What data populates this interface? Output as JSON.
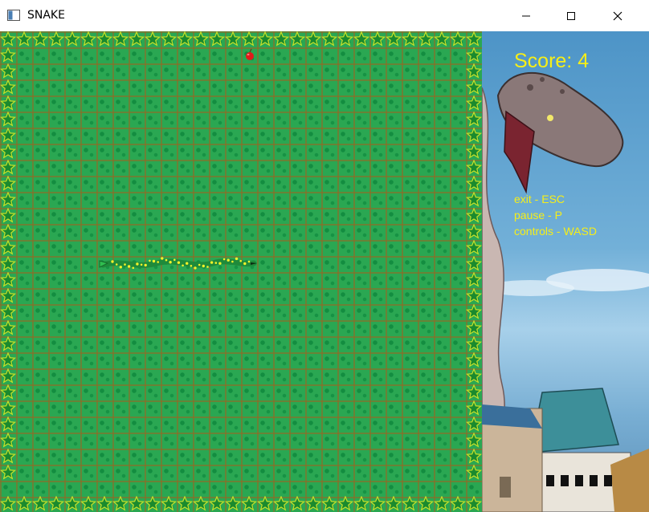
{
  "window": {
    "title": "SNAKE"
  },
  "hud": {
    "score_text": "Score: 4",
    "score": 4,
    "help": [
      "exit - ESC",
      "pause - P",
      "controls - WASD"
    ]
  },
  "board": {
    "background_color": "#2aa752",
    "snake_color": "#1f8a3a",
    "snake_spots_color": "#f2f22a",
    "food_color": "#e21b1b",
    "border_star_color": "#c6e02a"
  },
  "icons": {
    "app": "app-window-icon",
    "minimize": "minimize-icon",
    "maximize": "maximize-icon",
    "close": "close-icon"
  }
}
